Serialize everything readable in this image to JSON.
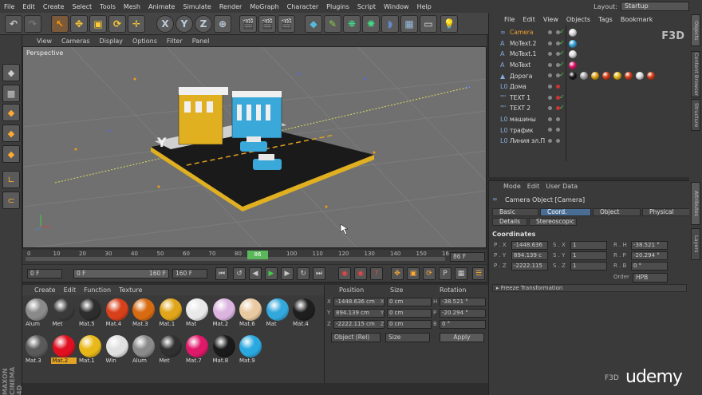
{
  "menubar": {
    "items": [
      "File",
      "Edit",
      "Create",
      "Select",
      "Tools",
      "Mesh",
      "Animate",
      "Simulate",
      "Render",
      "MoGraph",
      "Character",
      "Plugins",
      "Script",
      "Window",
      "Help"
    ],
    "layout_label": "Layout:",
    "layout_value": "Startup"
  },
  "viewport": {
    "menu": [
      "View",
      "Cameras",
      "Display",
      "Options",
      "Filter",
      "Panel"
    ],
    "label": "Perspective"
  },
  "timeline": {
    "ticks": [
      "0",
      "10",
      "20",
      "30",
      "40",
      "50",
      "60",
      "70",
      "80",
      "90",
      "100",
      "110",
      "120",
      "130",
      "140",
      "150",
      "16"
    ],
    "current_frame_marker": "86",
    "frame_field": "86 F"
  },
  "transport": {
    "start_field": "0 F",
    "current_field": "0 F",
    "range_end": "160 F",
    "end_field": "160 F"
  },
  "materials": {
    "menu": [
      "Create",
      "Edit",
      "Function",
      "Texture"
    ],
    "items": [
      {
        "name": "Alum",
        "color": "#8a8a8a"
      },
      {
        "name": "Met",
        "color": "#3a3a3a"
      },
      {
        "name": "Mat.5",
        "color": "#2d2d2d"
      },
      {
        "name": "Mat.4",
        "color": "#d8401a"
      },
      {
        "name": "Mat.3",
        "color": "#d86a12"
      },
      {
        "name": "Mat.1",
        "color": "#e0a51a"
      },
      {
        "name": "Mat",
        "color": "#e9e9e9"
      },
      {
        "name": "Mat.2",
        "color": "#dcb4e0"
      },
      {
        "name": "Mat.6",
        "color": "#e8c9a0"
      },
      {
        "name": "Mat",
        "color": "#33a8dd"
      },
      {
        "name": "Mat.4",
        "color": "#1e1e1e"
      },
      {
        "name": "Mat.3",
        "color": "#5a5a5a"
      },
      {
        "name": "Mat.2",
        "color": "#e01020",
        "selected": true
      },
      {
        "name": "Mat.1",
        "color": "#e8b818"
      },
      {
        "name": "Win",
        "color": "#e0e0e0"
      },
      {
        "name": "Alum",
        "color": "#8a8a8a"
      },
      {
        "name": "Met",
        "color": "#303030"
      },
      {
        "name": "Mat.7",
        "color": "#e0186a"
      },
      {
        "name": "Mat.8",
        "color": "#1a1a1a"
      },
      {
        "name": "Mat.9",
        "color": "#2aa8e0"
      }
    ]
  },
  "coords": {
    "headers": {
      "position": "Position",
      "size": "Size",
      "rotation": "Rotation"
    },
    "rows": [
      {
        "axis": "X",
        "pos": "-1448.636 cm",
        "size": "0 cm",
        "rlabel": "H",
        "rot": "-38.521 °"
      },
      {
        "axis": "Y",
        "pos": "894.139 cm",
        "size": "0 cm",
        "rlabel": "P",
        "rot": "-20.294 °"
      },
      {
        "axis": "Z",
        "pos": "-2222.115 cm",
        "size": "0 cm",
        "rlabel": "B",
        "rot": "0 °"
      }
    ],
    "mode_select": "Object (Rel)",
    "size_select": "Size",
    "apply": "Apply"
  },
  "objects": {
    "menu": [
      "File",
      "Edit",
      "View",
      "Objects",
      "Tags",
      "Bookmark"
    ],
    "items": [
      {
        "name": "Camera",
        "highlight": true,
        "icon": "camera-icon",
        "glyph": "∞"
      },
      {
        "name": "MoText.2",
        "icon": "motext-icon",
        "glyph": "A"
      },
      {
        "name": "MoText.1",
        "icon": "motext-icon",
        "glyph": "A"
      },
      {
        "name": "MoText",
        "icon": "motext-icon",
        "glyph": "A"
      },
      {
        "name": "Дорога",
        "icon": "extrude-icon",
        "glyph": "▲"
      },
      {
        "name": "Дома",
        "icon": "null-icon",
        "glyph": "L0"
      },
      {
        "name": "TEXT 1",
        "icon": "text-spline-icon",
        "glyph": "\"\""
      },
      {
        "name": "TEXT 2",
        "icon": "text-spline-icon",
        "glyph": "\"\""
      },
      {
        "name": "машины",
        "icon": "null-icon",
        "glyph": "L0"
      },
      {
        "name": "трафик",
        "icon": "null-icon",
        "glyph": "L0"
      },
      {
        "name": "Линия эл.П",
        "icon": "null-icon",
        "glyph": "L0"
      }
    ]
  },
  "attributes": {
    "menu": [
      "Mode",
      "Edit",
      "User Data"
    ],
    "title": "Camera Object [Camera]",
    "tabs": [
      "Basic",
      "Coord.",
      "Object",
      "Physical",
      "Details",
      "Stereoscopic"
    ],
    "active_tab": "Coord.",
    "section": "Coordinates",
    "fields": [
      {
        "label": "P . X",
        "value": "-1448.636",
        "slabel": "S . X",
        "svalue": "1",
        "rlabel": "R . H",
        "rvalue": "-38.521 °"
      },
      {
        "label": "P . Y",
        "value": "894.139 c",
        "slabel": "S . Y",
        "svalue": "1",
        "rlabel": "R . P",
        "rvalue": "-20.294 °"
      },
      {
        "label": "P . Z",
        "value": "-2222.115",
        "slabel": "S . Z",
        "svalue": "1",
        "rlabel": "R . B",
        "rvalue": "0 °"
      }
    ],
    "order_label": "Order",
    "order_value": "HPB",
    "freeze": "Freeze Transformation"
  },
  "sidetabs": [
    "Objects",
    "Content Browser",
    "Structure",
    "Attributes",
    "Layers"
  ],
  "branding": {
    "maxon": "MAXON CINEMA 4D",
    "f3d": "F3D",
    "udemy": "udemy"
  }
}
